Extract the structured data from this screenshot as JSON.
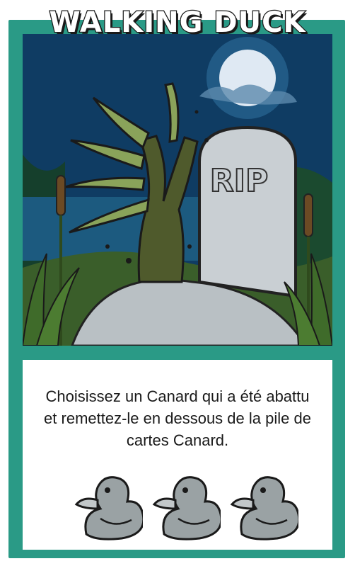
{
  "card": {
    "title": "WALKING DUCK",
    "art": {
      "description_icon": "zombie-hand-from-grave-icon",
      "tombstone_text": "RIP"
    },
    "rule_lines": [
      "Choisissez un Canard qui a été abattu",
      "et remettez-le en dessous de la pile de",
      "cartes Canard."
    ],
    "duck_icon": "duck-icon",
    "duck_count": 3,
    "colors": {
      "frame": "#2a9a86",
      "sky": "#0f3c63",
      "moon": "#dfe9f3",
      "tombstone": "#c9cfd3",
      "hand": "#4f5a2c"
    }
  }
}
